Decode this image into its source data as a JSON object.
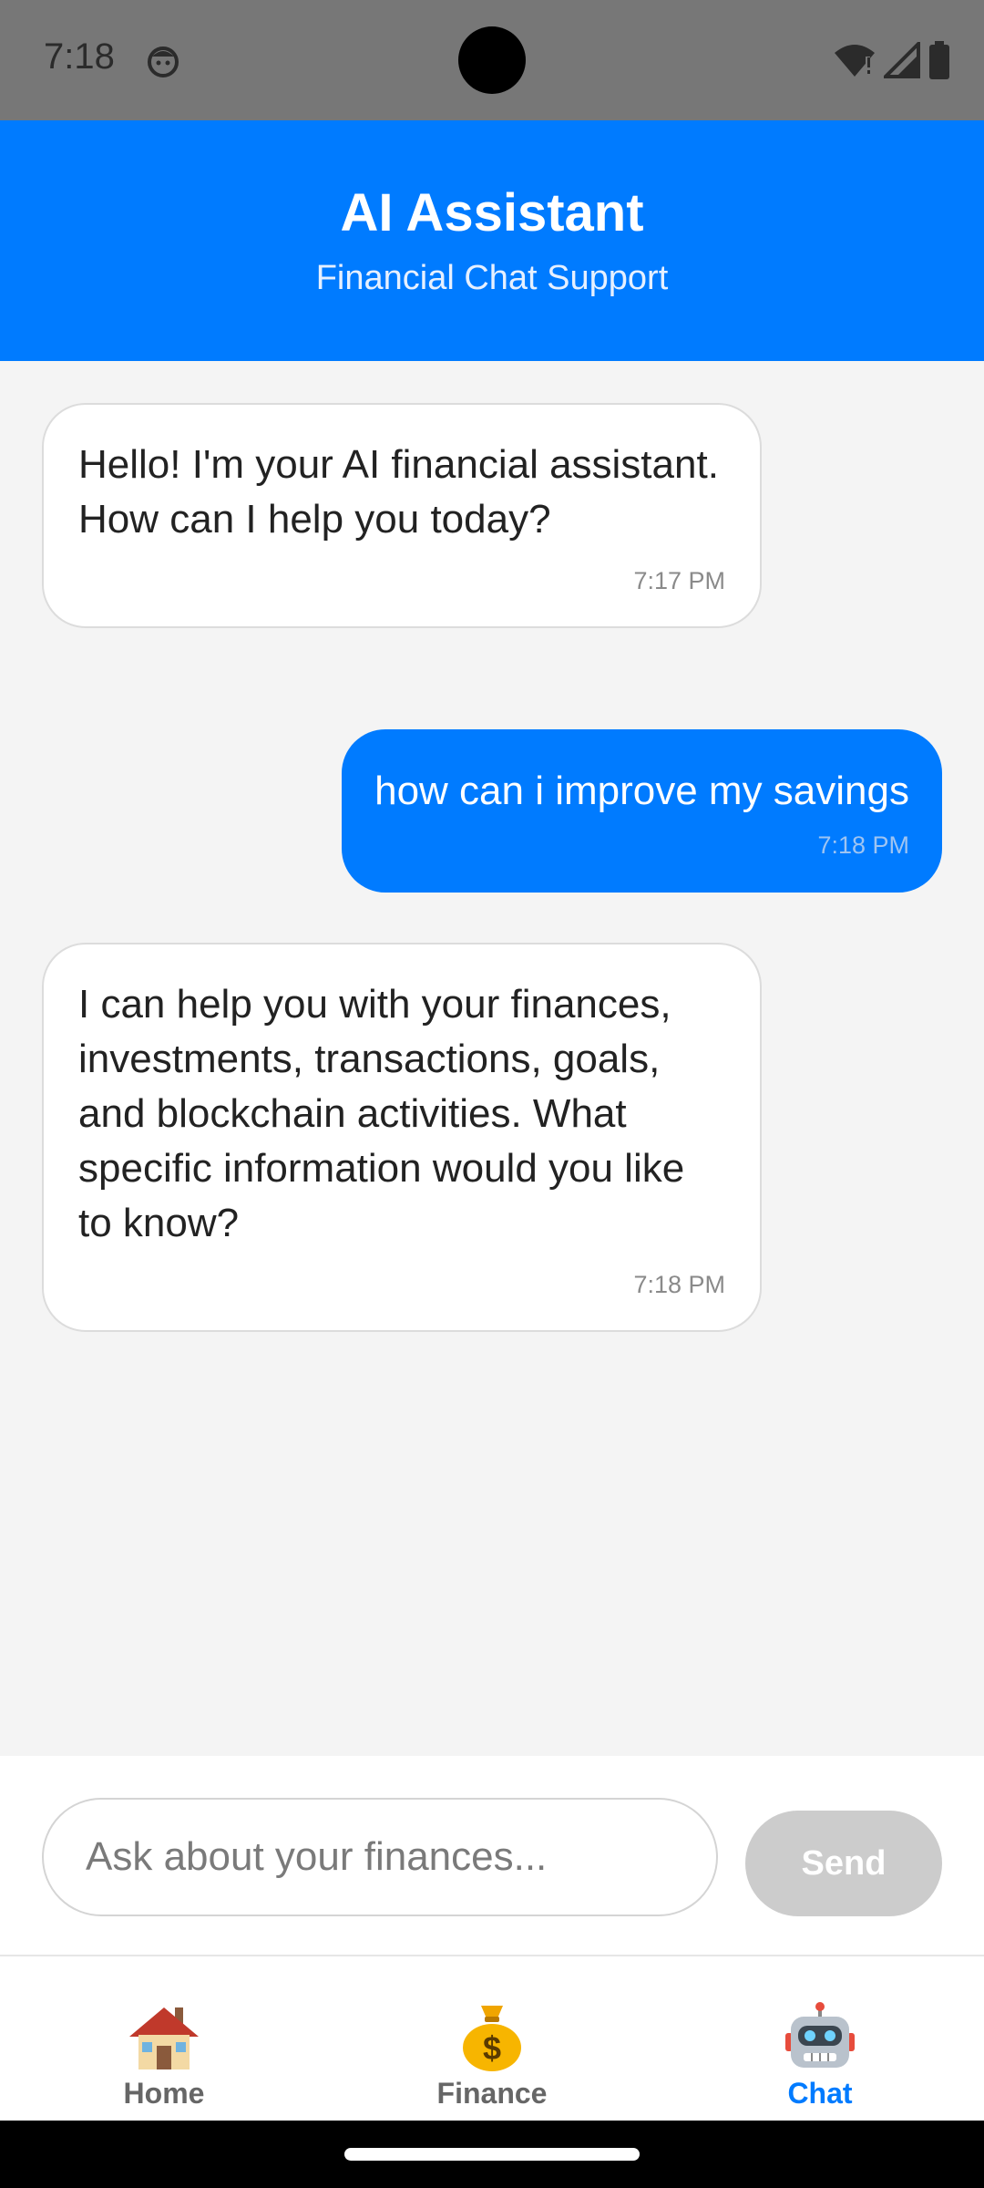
{
  "status_bar": {
    "time": "7:18",
    "icons": [
      "notification-face-icon",
      "wifi-alert-icon",
      "cell-signal-icon",
      "battery-icon"
    ]
  },
  "header": {
    "title": "AI Assistant",
    "subtitle": "Financial Chat Support"
  },
  "messages": [
    {
      "sender": "bot",
      "text": "Hello! I'm your AI financial assistant. How can I help you today?",
      "time": "7:17 PM"
    },
    {
      "sender": "user",
      "text": "how can i improve my savings",
      "time": "7:18 PM"
    },
    {
      "sender": "bot",
      "text": "I can help you with your finances, investments, transactions, goals, and blockchain activities. What specific information would you like to know?",
      "time": "7:18 PM"
    }
  ],
  "composer": {
    "placeholder": "Ask about your finances...",
    "value": "",
    "send_label": "Send"
  },
  "nav": {
    "items": [
      {
        "label": "Home",
        "icon": "house-icon",
        "active": false
      },
      {
        "label": "Finance",
        "icon": "money-bag-icon",
        "active": false
      },
      {
        "label": "Chat",
        "icon": "robot-icon",
        "active": true
      }
    ]
  },
  "colors": {
    "primary": "#007bff",
    "status_bar": "#777777",
    "background": "#f4f4f4",
    "send_disabled": "#cccccc"
  }
}
